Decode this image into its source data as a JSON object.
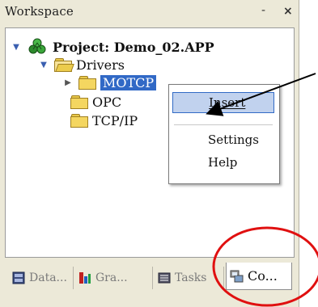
{
  "window": {
    "title": "Workspace",
    "pin_glyph": "-",
    "close_glyph": "×"
  },
  "tree": {
    "project": {
      "label": "Project: Demo_02.APP",
      "expanded": true
    },
    "drivers": {
      "label": "Drivers",
      "expanded": true
    },
    "motcp": {
      "label": "MOTCP",
      "expanded": false,
      "selected": true
    },
    "opc": {
      "label": "OPC"
    },
    "tcpip": {
      "label": "TCP/IP"
    }
  },
  "context_menu": {
    "items": [
      {
        "label": "Insert",
        "highlighted": true
      },
      {
        "label": "Settings"
      },
      {
        "label": "Help"
      }
    ]
  },
  "tabs": [
    {
      "label": "Data...",
      "icon": "database-icon",
      "active": false
    },
    {
      "label": "Gra...",
      "icon": "graphics-icon",
      "active": false
    },
    {
      "label": "Tasks",
      "icon": "tasks-icon",
      "active": false
    },
    {
      "label": "Co...",
      "icon": "comm-icon",
      "active": true
    }
  ],
  "annotations": {
    "arrow_color": "#000000",
    "circle_color": "#e01010"
  },
  "colors": {
    "selection": "#3169c6",
    "menu_highlight": "#c1d2ee",
    "panel_bg": "#ece9d8"
  }
}
